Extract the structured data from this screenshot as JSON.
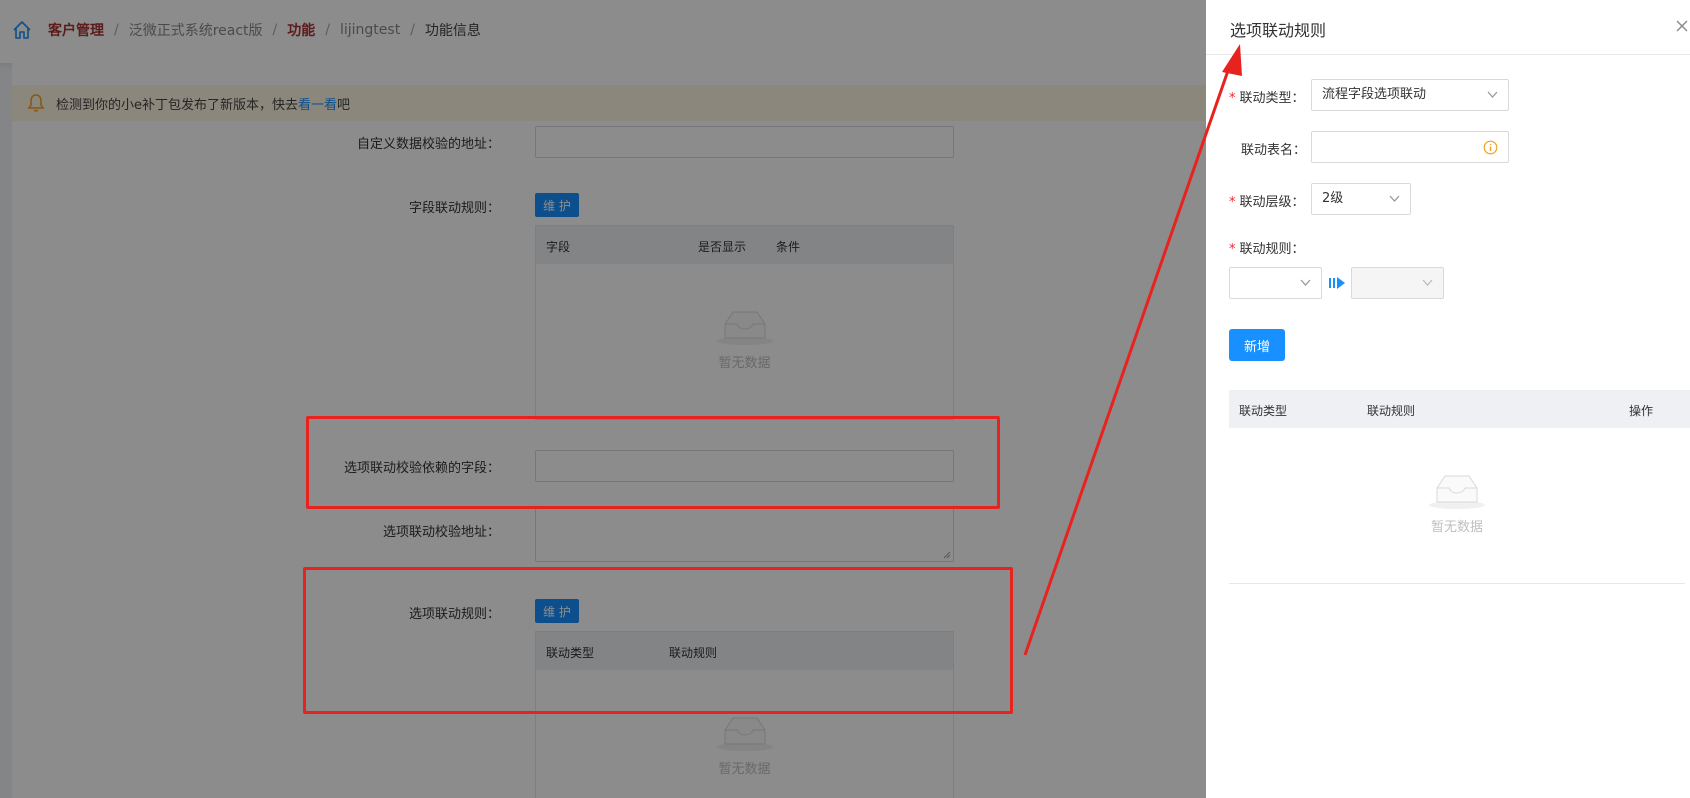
{
  "breadcrumb": {
    "items": [
      "客户管理",
      "泛微正式系统react版",
      "功能",
      "lijingtest",
      "功能信息"
    ],
    "separator": "/"
  },
  "notice": {
    "text_before": "检测到你的小e补丁包发布了新版本，快去",
    "link": "看一看",
    "text_after": "吧"
  },
  "form": {
    "custom_validate_url_label": "自定义数据校验的地址：",
    "field_rule_label": "字段联动规则：",
    "field_rule_button": "维 护",
    "field_table_columns": [
      "字段",
      "是否显示",
      "条件"
    ],
    "empty_text": "暂无数据",
    "option_dep_field_label": "选项联动校验依赖的字段：",
    "option_validate_url_label": "选项联动校验地址：",
    "option_rule_label": "选项联动规则：",
    "option_rule_button": "维 护",
    "option_table_columns": [
      "联动类型",
      "联动规则"
    ]
  },
  "drawer": {
    "title": "选项联动规则",
    "type_label": "联动类型：",
    "type_value": "流程字段选项联动",
    "table_name_label": "联动表名：",
    "table_name_value": "",
    "level_label": "联动层级：",
    "level_value": "2级",
    "rule_label": "联动规则：",
    "rule_select_1": "",
    "rule_select_2": "",
    "add_button": "新增",
    "table_columns": [
      "联动类型",
      "联动规则",
      "操作"
    ],
    "empty_text": "暂无数据",
    "required_mark": "*"
  },
  "colors": {
    "primary": "#1890ff",
    "annotation_red": "#e8231f",
    "required": "#f5222d",
    "notice_bg": "#fdf6e3"
  }
}
